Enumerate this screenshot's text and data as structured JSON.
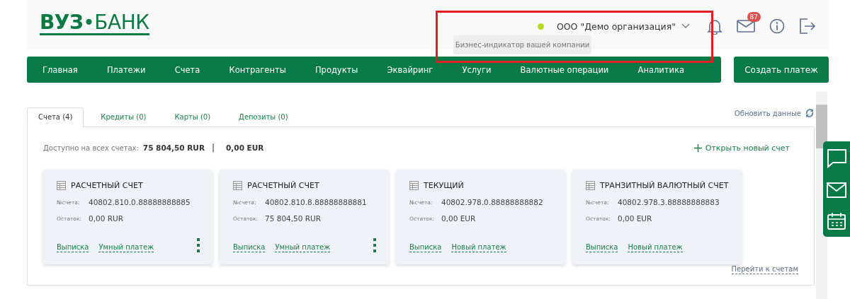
{
  "logo": "**ВУЗ**•БАНК",
  "header": {
    "organization": "ООО \"Демо организация\"",
    "tooltip": "Бизнес-индикатор вашей компании",
    "mail_badge": "87"
  },
  "nav": {
    "items": [
      "Главная",
      "Платежи",
      "Счета",
      "Контрагенты",
      "Продукты",
      "Эквайринг",
      "Услуги",
      "Валютные операции",
      "Аналитика"
    ],
    "create_button": "Создать платеж"
  },
  "tabs": [
    {
      "label": "Счета (4)",
      "selected": true
    },
    {
      "label": "Кредиты (0)",
      "selected": false
    },
    {
      "label": "Карты (0)",
      "selected": false
    },
    {
      "label": "Депозиты (0)",
      "selected": false
    }
  ],
  "refresh": "Обновить данные",
  "summary": {
    "label": "Доступно на всех счетах:",
    "rur": "75 804,50 RUR",
    "separator": "|",
    "eur": "0,00 EUR"
  },
  "open_account": "Открыть новый счет",
  "cards": [
    {
      "title": "РАСЧЕТНЫЙ СЧЕТ",
      "number_label": "№счета:",
      "number": "40802.810.0.88888888885",
      "balance_label": "Остаток:",
      "balance": "0,00 RUR",
      "links": [
        "Выписка",
        "Умный платеж"
      ],
      "menu": true
    },
    {
      "title": "РАСЧЕТНЫЙ СЧЕТ",
      "number_label": "№счета:",
      "number": "40802.810.8.88888888881",
      "balance_label": "Остаток:",
      "balance": "75 804,50 RUR",
      "links": [
        "Выписка",
        "Умный платеж"
      ],
      "menu": true
    },
    {
      "title": "ТЕКУЩИЙ",
      "number_label": "№счета:",
      "number": "40802.978.0.88888888882",
      "balance_label": "Остаток:",
      "balance": "0,00 EUR",
      "links": [
        "Выписка",
        "Новый платеж"
      ],
      "menu": false
    },
    {
      "title": "ТРАНЗИТНЫЙ ВАЛЮТНЫЙ СЧЕТ",
      "number_label": "№счета:",
      "number": "40802.978.3.88888888883",
      "balance_label": "Остаток:",
      "balance": "0,00 EUR",
      "links": [
        "Выписка",
        "Новый платеж"
      ],
      "menu": false
    }
  ],
  "goto_accounts": "Перейти к счетам"
}
